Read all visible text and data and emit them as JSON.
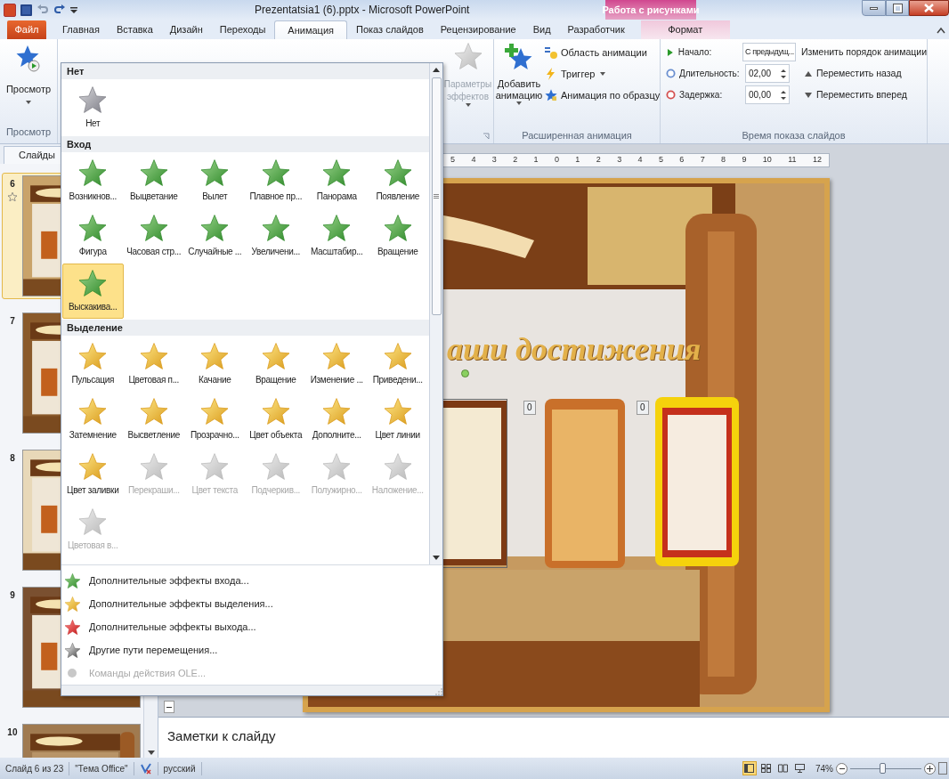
{
  "window": {
    "title": "Prezentatsia1 (6).pptx - Microsoft PowerPoint",
    "context_group": "Работа с рисунками"
  },
  "tabs": [
    {
      "label": "Файл",
      "kind": "file",
      "selected": false
    },
    {
      "label": "Главная",
      "kind": "normal",
      "selected": false
    },
    {
      "label": "Вставка",
      "kind": "normal",
      "selected": false
    },
    {
      "label": "Дизайн",
      "kind": "normal",
      "selected": false
    },
    {
      "label": "Переходы",
      "kind": "normal",
      "selected": false
    },
    {
      "label": "Анимация",
      "kind": "normal",
      "selected": true
    },
    {
      "label": "Показ слайдов",
      "kind": "normal",
      "selected": false
    },
    {
      "label": "Рецензирование",
      "kind": "normal",
      "selected": false
    },
    {
      "label": "Вид",
      "kind": "normal",
      "selected": false
    },
    {
      "label": "Разработчик",
      "kind": "normal",
      "selected": false
    },
    {
      "label": "Формат",
      "kind": "context",
      "selected": false
    }
  ],
  "ribbon": {
    "preview": {
      "button": "Просмотр",
      "group": "Просмотр"
    },
    "effect_options": {
      "label": "Параметры эффектов",
      "disabled": true
    },
    "advanced": {
      "group": "Расширенная анимация",
      "add_button": "Добавить анимацию",
      "commands": [
        {
          "label": "Область анимации",
          "kind": "pane"
        },
        {
          "label": "Триггер",
          "kind": "trigger"
        },
        {
          "label": "Анимация по образцу",
          "kind": "painter"
        }
      ]
    },
    "timing": {
      "group": "Время показа слайдов",
      "start": {
        "label": "Начало:",
        "value": "С предыдущ..."
      },
      "duration": {
        "label": "Длительность:",
        "value": "02,00"
      },
      "delay": {
        "label": "Задержка:",
        "value": "00,00"
      },
      "reorder_title": "Изменить порядок анимации",
      "move_earlier": "Переместить назад",
      "move_later": "Переместить вперед"
    }
  },
  "slides_panel": {
    "tab": "Слайды",
    "slides": [
      {
        "number": "6",
        "selected": true,
        "animated": true
      },
      {
        "number": "7",
        "selected": false,
        "animated": false
      },
      {
        "number": "8",
        "selected": false,
        "animated": false
      },
      {
        "number": "9",
        "selected": false,
        "animated": false
      },
      {
        "number": "10",
        "selected": false,
        "animated": false
      }
    ]
  },
  "editor": {
    "ruler": [
      "5",
      "4",
      "3",
      "2",
      "1",
      "0",
      "1",
      "2",
      "3",
      "4",
      "5",
      "6",
      "7",
      "8",
      "9",
      "10",
      "11",
      "12"
    ],
    "slide_title": "аши достижения",
    "animation_tags": [
      "0",
      "0"
    ]
  },
  "notes": {
    "placeholder": "Заметки к слайду"
  },
  "gallery": {
    "sections": [
      {
        "title": "Нет",
        "items": [
          {
            "label": "Нет",
            "kind": "none",
            "selected": false,
            "disabled": false
          }
        ]
      },
      {
        "title": "Вход",
        "items": [
          {
            "label": "Возникнов...",
            "kind": "entrance",
            "selected": false,
            "disabled": false
          },
          {
            "label": "Выцветание",
            "kind": "entrance",
            "selected": false,
            "disabled": false
          },
          {
            "label": "Вылет",
            "kind": "entrance",
            "selected": false,
            "disabled": false
          },
          {
            "label": "Плавное пр...",
            "kind": "entrance",
            "selected": false,
            "disabled": false
          },
          {
            "label": "Панорама",
            "kind": "entrance",
            "selected": false,
            "disabled": false
          },
          {
            "label": "Появление",
            "kind": "entrance",
            "selected": false,
            "disabled": false
          },
          {
            "label": "Фигура",
            "kind": "entrance",
            "selected": false,
            "disabled": false
          },
          {
            "label": "Часовая стр...",
            "kind": "entrance",
            "selected": false,
            "disabled": false
          },
          {
            "label": "Случайные ...",
            "kind": "entrance",
            "selected": false,
            "disabled": false
          },
          {
            "label": "Увеличени...",
            "kind": "entrance",
            "selected": false,
            "disabled": false
          },
          {
            "label": "Масштабир...",
            "kind": "entrance",
            "selected": false,
            "disabled": false
          },
          {
            "label": "Вращение",
            "kind": "entrance",
            "selected": false,
            "disabled": false
          },
          {
            "label": "Выскакива...",
            "kind": "entrance",
            "selected": true,
            "disabled": false
          }
        ]
      },
      {
        "title": "Выделение",
        "items": [
          {
            "label": "Пульсация",
            "kind": "emphasis",
            "selected": false,
            "disabled": false
          },
          {
            "label": "Цветовая п...",
            "kind": "emphasis",
            "selected": false,
            "disabled": false
          },
          {
            "label": "Качание",
            "kind": "emphasis",
            "selected": false,
            "disabled": false
          },
          {
            "label": "Вращение",
            "kind": "emphasis",
            "selected": false,
            "disabled": false
          },
          {
            "label": "Изменение ...",
            "kind": "emphasis",
            "selected": false,
            "disabled": false
          },
          {
            "label": "Приведени...",
            "kind": "emphasis",
            "selected": false,
            "disabled": false
          },
          {
            "label": "Затемнение",
            "kind": "emphasis",
            "selected": false,
            "disabled": false
          },
          {
            "label": "Высветление",
            "kind": "emphasis",
            "selected": false,
            "disabled": false
          },
          {
            "label": "Прозрачно...",
            "kind": "emphasis",
            "selected": false,
            "disabled": false
          },
          {
            "label": "Цвет объекта",
            "kind": "emphasis",
            "selected": false,
            "disabled": false
          },
          {
            "label": "Дополните...",
            "kind": "emphasis",
            "selected": false,
            "disabled": false
          },
          {
            "label": "Цвет линии",
            "kind": "emphasis",
            "selected": false,
            "disabled": false
          },
          {
            "label": "Цвет заливки",
            "kind": "emphasis",
            "selected": false,
            "disabled": false
          },
          {
            "label": "Перекраши...",
            "kind": "emphasis",
            "selected": false,
            "disabled": true
          },
          {
            "label": "Цвет текста",
            "kind": "emphasis",
            "selected": false,
            "disabled": true
          },
          {
            "label": "Подчеркив...",
            "kind": "emphasis",
            "selected": false,
            "disabled": true
          },
          {
            "label": "Полужирно...",
            "kind": "emphasis",
            "selected": false,
            "disabled": true
          },
          {
            "label": "Наложение...",
            "kind": "emphasis",
            "selected": false,
            "disabled": true
          },
          {
            "label": "Цветовая в...",
            "kind": "emphasis",
            "selected": false,
            "disabled": true
          }
        ]
      }
    ],
    "menu": [
      {
        "label": "Дополнительные эффекты входа...",
        "kind": "entrance",
        "disabled": false
      },
      {
        "label": "Дополнительные эффекты выделения...",
        "kind": "emphasis",
        "disabled": false
      },
      {
        "label": "Дополнительные эффекты выхода...",
        "kind": "exit",
        "disabled": false
      },
      {
        "label": "Другие пути перемещения...",
        "kind": "path",
        "disabled": false
      },
      {
        "label": "Команды действия OLE...",
        "kind": "ole",
        "disabled": true
      }
    ]
  },
  "status_bar": {
    "slide": "Слайд 6 из 23",
    "theme": "\"Тема Office\"",
    "language": "русский",
    "views": [
      {
        "kind": "normal",
        "selected": true
      },
      {
        "kind": "sorter",
        "selected": false
      },
      {
        "kind": "reading",
        "selected": false
      },
      {
        "kind": "show",
        "selected": false
      }
    ],
    "zoom": "74%",
    "zoom_slider": {
      "level": 0.45
    }
  }
}
